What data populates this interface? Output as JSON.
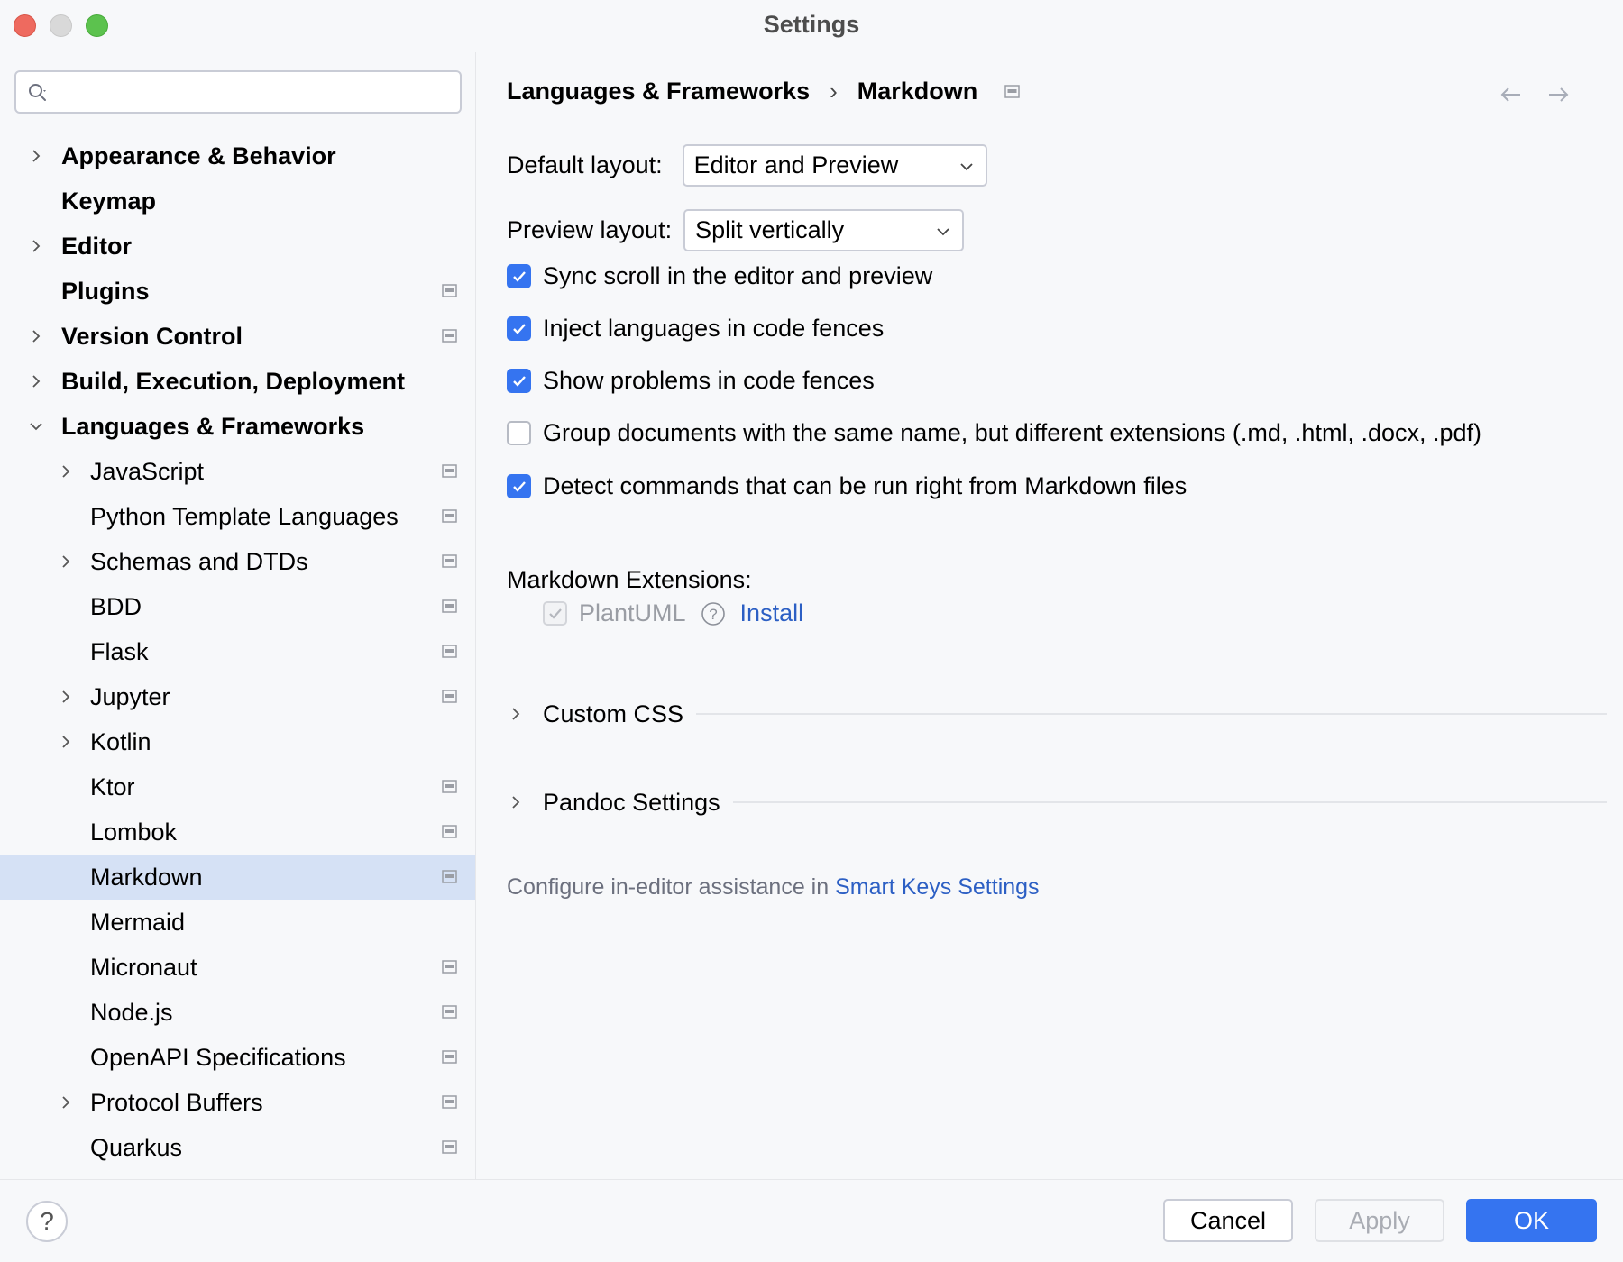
{
  "window": {
    "title": "Settings"
  },
  "search": {
    "placeholder": "",
    "value": ""
  },
  "sidebar": {
    "items": [
      {
        "label": "Appearance & Behavior",
        "level": 0,
        "expandable": true,
        "expanded": false,
        "bold": true,
        "page_icon": false
      },
      {
        "label": "Keymap",
        "level": 0,
        "expandable": false,
        "bold": true,
        "page_icon": false
      },
      {
        "label": "Editor",
        "level": 0,
        "expandable": true,
        "expanded": false,
        "bold": true,
        "page_icon": false
      },
      {
        "label": "Plugins",
        "level": 0,
        "expandable": false,
        "bold": true,
        "page_icon": true
      },
      {
        "label": "Version Control",
        "level": 0,
        "expandable": true,
        "expanded": false,
        "bold": true,
        "page_icon": true
      },
      {
        "label": "Build, Execution, Deployment",
        "level": 0,
        "expandable": true,
        "expanded": false,
        "bold": true,
        "page_icon": false
      },
      {
        "label": "Languages & Frameworks",
        "level": 0,
        "expandable": true,
        "expanded": true,
        "bold": true,
        "page_icon": false
      },
      {
        "label": "JavaScript",
        "level": 1,
        "expandable": true,
        "expanded": false,
        "bold": false,
        "page_icon": true
      },
      {
        "label": "Python Template Languages",
        "level": 1,
        "expandable": false,
        "bold": false,
        "page_icon": true
      },
      {
        "label": "Schemas and DTDs",
        "level": 1,
        "expandable": true,
        "expanded": false,
        "bold": false,
        "page_icon": true
      },
      {
        "label": "BDD",
        "level": 1,
        "expandable": false,
        "bold": false,
        "page_icon": true
      },
      {
        "label": "Flask",
        "level": 1,
        "expandable": false,
        "bold": false,
        "page_icon": true
      },
      {
        "label": "Jupyter",
        "level": 1,
        "expandable": true,
        "expanded": false,
        "bold": false,
        "page_icon": true
      },
      {
        "label": "Kotlin",
        "level": 1,
        "expandable": true,
        "expanded": false,
        "bold": false,
        "page_icon": false
      },
      {
        "label": "Ktor",
        "level": 1,
        "expandable": false,
        "bold": false,
        "page_icon": true
      },
      {
        "label": "Lombok",
        "level": 1,
        "expandable": false,
        "bold": false,
        "page_icon": true
      },
      {
        "label": "Markdown",
        "level": 1,
        "expandable": false,
        "bold": false,
        "page_icon": true,
        "selected": true
      },
      {
        "label": "Mermaid",
        "level": 1,
        "expandable": false,
        "bold": false,
        "page_icon": false
      },
      {
        "label": "Micronaut",
        "level": 1,
        "expandable": false,
        "bold": false,
        "page_icon": true
      },
      {
        "label": "Node.js",
        "level": 1,
        "expandable": false,
        "bold": false,
        "page_icon": true
      },
      {
        "label": "OpenAPI Specifications",
        "level": 1,
        "expandable": false,
        "bold": false,
        "page_icon": true
      },
      {
        "label": "Protocol Buffers",
        "level": 1,
        "expandable": true,
        "expanded": false,
        "bold": false,
        "page_icon": true
      },
      {
        "label": "Quarkus",
        "level": 1,
        "expandable": false,
        "bold": false,
        "page_icon": true
      }
    ]
  },
  "breadcrumb": {
    "parent": "Languages & Frameworks",
    "separator": "›",
    "current": "Markdown"
  },
  "form": {
    "default_layout": {
      "label": "Default layout:",
      "value": "Editor and Preview"
    },
    "preview_layout": {
      "label": "Preview layout:",
      "value": "Split vertically"
    },
    "checkboxes": [
      {
        "label": "Sync scroll in the editor and preview",
        "checked": true
      },
      {
        "label": "Inject languages in code fences",
        "checked": true
      },
      {
        "label": "Show problems in code fences",
        "checked": true
      },
      {
        "label": "Group documents with the same name, but different extensions (.md, .html, .docx, .pdf)",
        "checked": false
      },
      {
        "label": "Detect commands that can be run right from Markdown files",
        "checked": true
      }
    ],
    "extensions": {
      "label": "Markdown Extensions:",
      "items": [
        {
          "name": "PlantUML",
          "checked": true,
          "enabled": false,
          "action": "Install"
        }
      ]
    },
    "sections": [
      {
        "label": "Custom CSS"
      },
      {
        "label": "Pandoc Settings"
      }
    ],
    "hint": {
      "text": "Configure in-editor assistance in ",
      "link": "Smart Keys Settings"
    }
  },
  "footer": {
    "help": "?",
    "cancel": "Cancel",
    "apply": "Apply",
    "ok": "OK"
  },
  "colors": {
    "accent": "#3574f0",
    "link": "#2c5fc4",
    "selection": "#d5e1f5",
    "background": "#f7f8fa"
  }
}
